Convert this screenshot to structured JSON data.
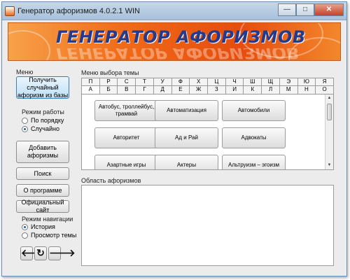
{
  "window": {
    "title": "Генератор афоризмов 4.0.2.1 WIN",
    "buttons": {
      "minimize": "—",
      "maximize": "□",
      "close": "✕"
    }
  },
  "banner": {
    "title": "ГЕНЕРАТОР АФОРИЗМОВ"
  },
  "sidebar": {
    "menu_label": "Меню",
    "random_button": "Получить случайный афоризм из базы",
    "mode_label": "Режим работы",
    "mode_options": [
      {
        "label": "По порядку",
        "checked": false
      },
      {
        "label": "Случайно",
        "checked": true
      }
    ],
    "add_button": "Добавить афоризмы",
    "search_button": "Поиск",
    "about_button": "О программе",
    "site_button": "Официальный сайт",
    "nav_mode_label": "Режим навигации",
    "nav_options": [
      {
        "label": "История",
        "checked": true
      },
      {
        "label": "Просмотр темы",
        "checked": false
      }
    ],
    "nav_buttons": {
      "back": "🡐",
      "refresh": "↻",
      "forward": "🡒"
    }
  },
  "topics": {
    "label": "Меню выбора темы",
    "letters_row1": [
      "П",
      "Р",
      "С",
      "Т",
      "У",
      "Ф",
      "Х",
      "Ц",
      "Ч",
      "Ш",
      "Щ",
      "Э",
      "Ю",
      "Я"
    ],
    "letters_row2": [
      "А",
      "Б",
      "В",
      "Г",
      "Д",
      "Е",
      "Ж",
      "З",
      "И",
      "К",
      "Л",
      "М",
      "Н",
      "О"
    ],
    "active_letter": "А",
    "items": [
      "Автобус, троллейбус, трамвай",
      "Автоматизация",
      "Автомобили",
      "Авторитет",
      "Ад и Рай",
      "Адвокаты",
      "Азартные игры",
      "Актеры",
      "Альтруизм – эгоизм"
    ]
  },
  "aphorisms": {
    "label": "Область афоризмов",
    "text": ""
  }
}
